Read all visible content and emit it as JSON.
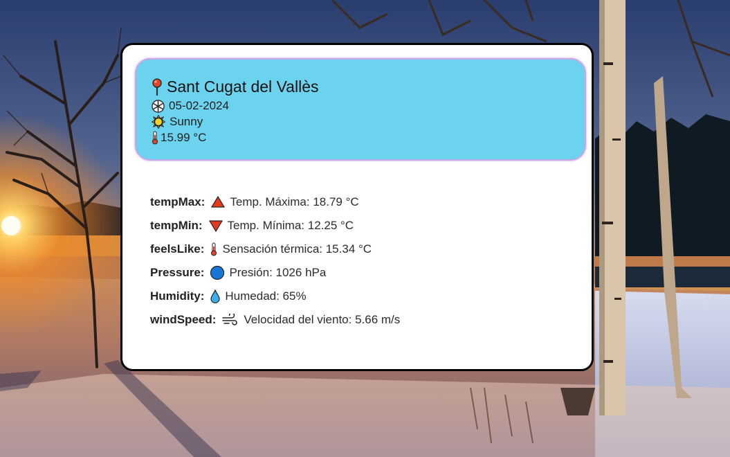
{
  "weather": {
    "location": "Sant Cugat del Vallès",
    "date": "05-02-2024",
    "condition": "Sunny",
    "temperature": "15.99 °C",
    "icons": {
      "location": "pin-icon",
      "date": "snowflake-icon",
      "condition": "sun-icon",
      "temperature": "thermometer-icon"
    }
  },
  "details": [
    {
      "key": "tempMax:",
      "icon": "triangle-up-icon",
      "label": "Temp. Máxima: 18.79 °C"
    },
    {
      "key": "tempMin:",
      "icon": "triangle-down-icon",
      "label": "Temp. Mínima: 12.25 °C"
    },
    {
      "key": "feelsLike:",
      "icon": "thermometer-icon",
      "label": "Sensación térmica: 15.34 °C"
    },
    {
      "key": "Pressure:",
      "icon": "blue-circle-icon",
      "label": "Presión: 1026 hPa"
    },
    {
      "key": "Humidity:",
      "icon": "droplet-icon",
      "label": "Humedad: 65%"
    },
    {
      "key": "windSpeed:",
      "icon": "wind-icon",
      "label": "Velocidad del viento: 5.66 m/s"
    }
  ],
  "colors": {
    "header_bg": "#6bd3ee",
    "card_bg": "#ffffff",
    "card_border": "#000000",
    "header_border": "#c9a6e8"
  }
}
